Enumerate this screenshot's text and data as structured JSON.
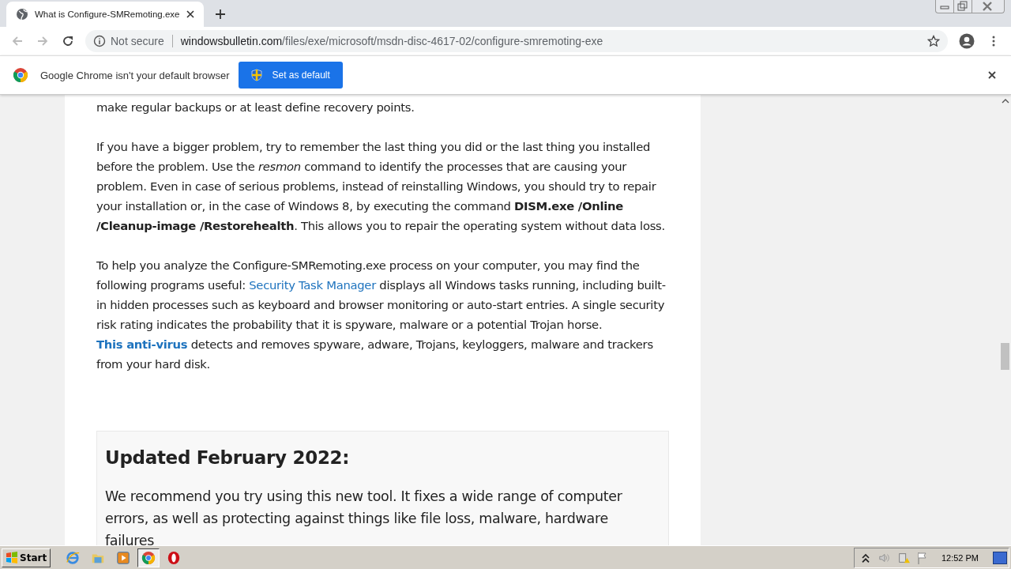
{
  "tab": {
    "title": "What is Configure-SMRemoting.exe",
    "selected": true
  },
  "address": {
    "security": "Not secure",
    "domain": "windowsbulletin.com",
    "path": "/files/exe/microsoft/msdn-disc-4617-02/configure-smremoting-exe"
  },
  "infobar": {
    "message": "Google Chrome isn't your default browser",
    "button": "Set as default"
  },
  "article": {
    "paragraphs": [
      [
        {
          "kind": "text",
          "text": "make regular backups or at least define recovery points."
        }
      ],
      [
        {
          "kind": "text",
          "text": "If you have a bigger problem, try to remember the last thing you did or the last thing you installed before the problem. Use the *resmon* command to identify the processes that are causing your problem. Even in case of serious problems, instead of reinstalling Windows, you should try to repair your installation or, in the case of Windows 8, by executing the command **DISM.exe /Online /Cleanup-image /Restorehealth**. This allows you to repair the operating system without data loss."
        }
      ],
      [
        {
          "kind": "text",
          "text": "To help you analyze the Configure-SMRemoting.exe process on your computer, you may find the following programs useful: "
        },
        {
          "kind": "link",
          "text": "Security Task Manager",
          "bold": false
        },
        {
          "kind": "text",
          "text": " displays all Windows tasks running, including built-in hidden processes such as keyboard and browser monitoring or auto-start entries. A single security risk rating indicates the probability that it is spyware, malware or a potential Trojan horse. "
        },
        {
          "kind": "link",
          "text": "This anti-virus",
          "bold": true
        },
        {
          "kind": "text",
          "text": " detects and removes spyware, adware, Trojans, keyloggers, malware and trackers from your hard disk."
        }
      ]
    ],
    "update": {
      "heading": "Updated February 2022:",
      "text": "We recommend you try using this new tool. It fixes a wide range of computer errors, as well as protecting against things like file loss, malware, hardware failures"
    }
  },
  "taskbar": {
    "start": "Start",
    "apps": [
      {
        "kind": "ie",
        "selected": false
      },
      {
        "kind": "folder",
        "selected": false
      },
      {
        "kind": "media",
        "selected": false
      },
      {
        "kind": "chrome",
        "selected": true
      },
      {
        "kind": "opera",
        "selected": false
      }
    ],
    "clock": "12:52 PM"
  }
}
